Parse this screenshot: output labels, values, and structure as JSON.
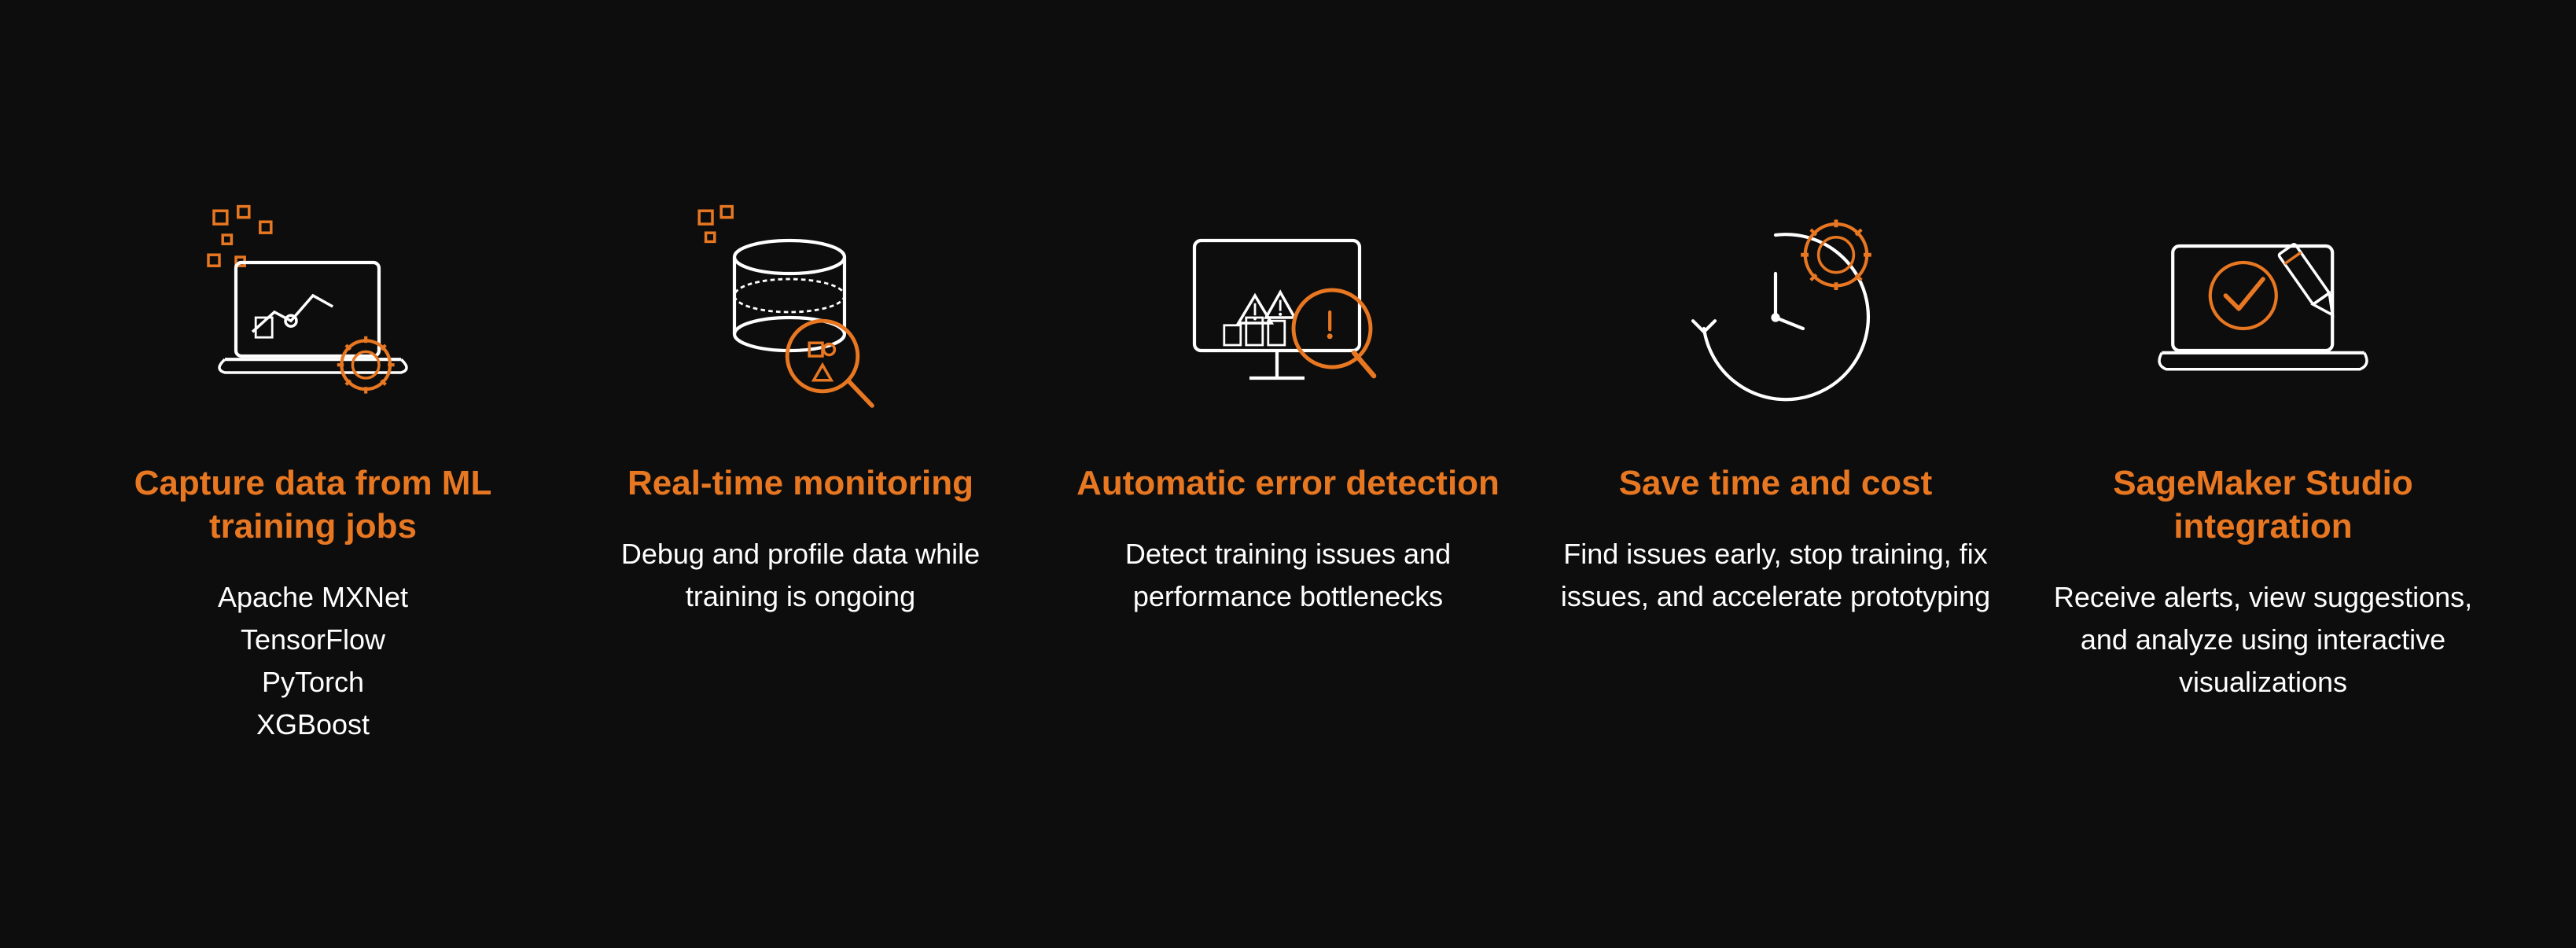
{
  "features": [
    {
      "id": "capture-data",
      "title": "Capture data from ML training jobs",
      "description": "Apache MXNet\nTensorFlow\nPyTorch\nXGBoost",
      "icon": "laptop-gear"
    },
    {
      "id": "realtime-monitoring",
      "title": "Real-time monitoring",
      "description": "Debug and profile data while training is ongoing",
      "icon": "database-magnify"
    },
    {
      "id": "auto-error-detection",
      "title": "Automatic error detection",
      "description": "Detect training issues and performance bottlenecks",
      "icon": "screen-warning"
    },
    {
      "id": "save-time-cost",
      "title": "Save time and cost",
      "description": "Find issues early, stop training, fix issues, and accelerate prototyping",
      "icon": "clock-gear"
    },
    {
      "id": "sagemaker-studio",
      "title": "SageMaker Studio integration",
      "description": "Receive alerts, view suggestions, and analyze using interactive visualizations",
      "icon": "laptop-check-pencil"
    }
  ]
}
